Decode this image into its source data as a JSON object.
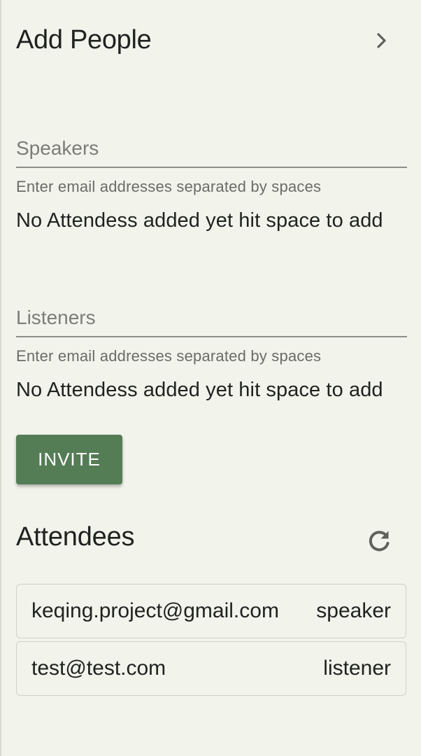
{
  "header": {
    "title": "Add People",
    "next_icon": "chevron-right-icon"
  },
  "speakers": {
    "placeholder": "Speakers",
    "value": "",
    "helper": "Enter email addresses separated by spaces",
    "empty_note": "No Attendess added yet hit space to add"
  },
  "listeners": {
    "placeholder": "Listeners",
    "value": "",
    "helper": "Enter email addresses separated by spaces",
    "empty_note": "No Attendess added yet hit space to add"
  },
  "invite": {
    "label": "INVITE"
  },
  "attendees": {
    "title": "Attendees",
    "refresh_icon": "refresh-icon",
    "items": [
      {
        "email": "keqing.project@gmail.com",
        "role": "speaker"
      },
      {
        "email": "test@test.com",
        "role": "listener"
      }
    ]
  },
  "colors": {
    "background": "#f2f3eb",
    "accent": "#547d56",
    "text": "#1f221f",
    "muted": "#6a6c66"
  }
}
